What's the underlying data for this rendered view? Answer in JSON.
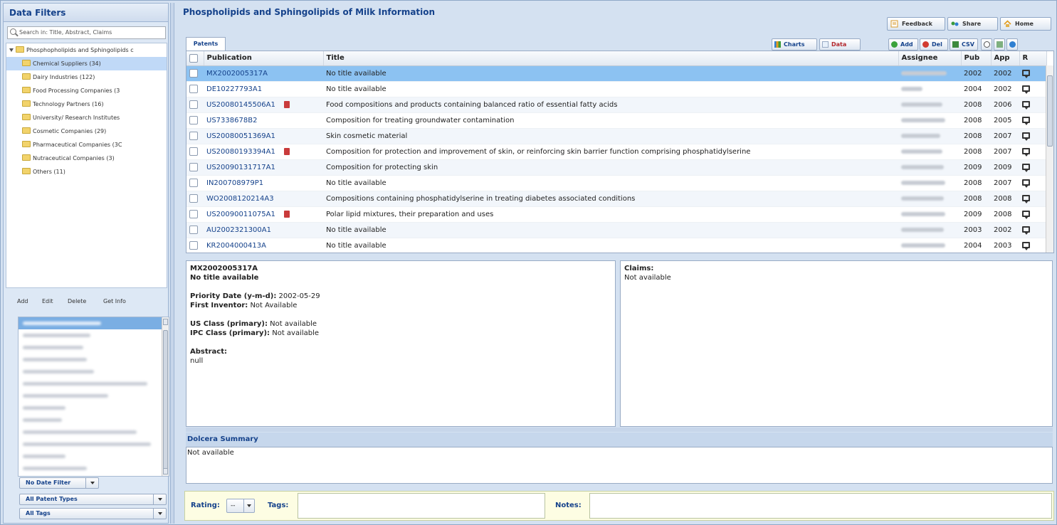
{
  "left": {
    "title": "Data Filters",
    "search_placeholder": "Search in: Title, Abstract, Claims",
    "tree_root": "Phosphopholipids and Sphingolipids c",
    "tree_items": [
      {
        "label": "Chemical Suppliers (34)",
        "selected": true
      },
      {
        "label": "Dairy Industries (122)",
        "selected": false
      },
      {
        "label": "Food Processing Companies (3",
        "selected": false
      },
      {
        "label": "Technology Partners (16)",
        "selected": false
      },
      {
        "label": "University/ Research Institutes",
        "selected": false
      },
      {
        "label": "Cosmetic Companies (29)",
        "selected": false
      },
      {
        "label": "Pharmaceutical Companies (3C",
        "selected": false
      },
      {
        "label": "Nutraceutical Companies (3)",
        "selected": false
      },
      {
        "label": "Others (11)",
        "selected": false
      }
    ],
    "actions": {
      "add": "Add",
      "edit": "Edit",
      "delete": "Delete",
      "get_info": "Get Info"
    },
    "date_filter": "No Date Filter",
    "patent_types": "All Patent Types",
    "tags": "All Tags"
  },
  "main": {
    "title": "Phospholipids and Sphingolipids of Milk Information",
    "buttons": {
      "feedback": "Feedback",
      "share": "Share",
      "home": "Home"
    },
    "tab": "Patents",
    "toolbar": {
      "charts": "Charts",
      "data": "Data",
      "add": "Add",
      "del": "Del",
      "csv": "CSV"
    },
    "columns": {
      "publication": "Publication",
      "title": "Title",
      "assignee": "Assignee",
      "pub": "Pub",
      "app": "App",
      "r": "R"
    },
    "rows": [
      {
        "pub_no": "MX2002005317A",
        "title": "No title available",
        "pub": "2002",
        "app": "2002",
        "pdf": false
      },
      {
        "pub_no": "DE10227793A1",
        "title": "No title available",
        "pub": "2004",
        "app": "2002",
        "pdf": false
      },
      {
        "pub_no": "US20080145506A1",
        "title": "Food compositions and products containing balanced ratio of essential fatty acids",
        "pub": "2008",
        "app": "2006",
        "pdf": true
      },
      {
        "pub_no": "US7338678B2",
        "title": "Composition for treating groundwater contamination",
        "pub": "2008",
        "app": "2005",
        "pdf": false
      },
      {
        "pub_no": "US20080051369A1",
        "title": "Skin cosmetic material",
        "pub": "2008",
        "app": "2007",
        "pdf": false
      },
      {
        "pub_no": "US20080193394A1",
        "title": "Composition for protection and improvement of skin, or reinforcing skin barrier function comprising phosphatidylserine",
        "pub": "2008",
        "app": "2007",
        "pdf": true
      },
      {
        "pub_no": "US20090131717A1",
        "title": "Composition for protecting skin",
        "pub": "2009",
        "app": "2009",
        "pdf": false
      },
      {
        "pub_no": "IN200708979P1",
        "title": "No title available",
        "pub": "2008",
        "app": "2007",
        "pdf": false
      },
      {
        "pub_no": "WO2008120214A3",
        "title": "Compositions containing phosphatidylserine in treating diabetes associated conditions",
        "pub": "2008",
        "app": "2008",
        "pdf": false
      },
      {
        "pub_no": "US20090011075A1",
        "title": "Polar lipid mixtures, their preparation and uses",
        "pub": "2009",
        "app": "2008",
        "pdf": true
      },
      {
        "pub_no": "AU2002321300A1",
        "title": "No title available",
        "pub": "2003",
        "app": "2002",
        "pdf": false
      },
      {
        "pub_no": "KR2004000413A",
        "title": "No title available",
        "pub": "2004",
        "app": "2003",
        "pdf": false
      }
    ],
    "detail": {
      "pub_no": "MX2002005317A",
      "title": "No title available",
      "priority_label": "Priority Date (y-m-d):",
      "priority_value": "2002-05-29",
      "inventor_label": "First Inventor:",
      "inventor_value": "Not Available",
      "us_class_label": "US Class (primary):",
      "us_class_value": "Not available",
      "ipc_class_label": "IPC Class (primary):",
      "ipc_class_value": "Not available",
      "abstract_label": "Abstract:",
      "abstract_value": "null"
    },
    "claims": {
      "label": "Claims:",
      "value": "Not available"
    },
    "summary": {
      "label": "Dolcera Summary",
      "value": "Not available"
    },
    "rating": {
      "rating_label": "Rating:",
      "rating_value": "--",
      "tags_label": "Tags:",
      "notes_label": "Notes:"
    }
  }
}
